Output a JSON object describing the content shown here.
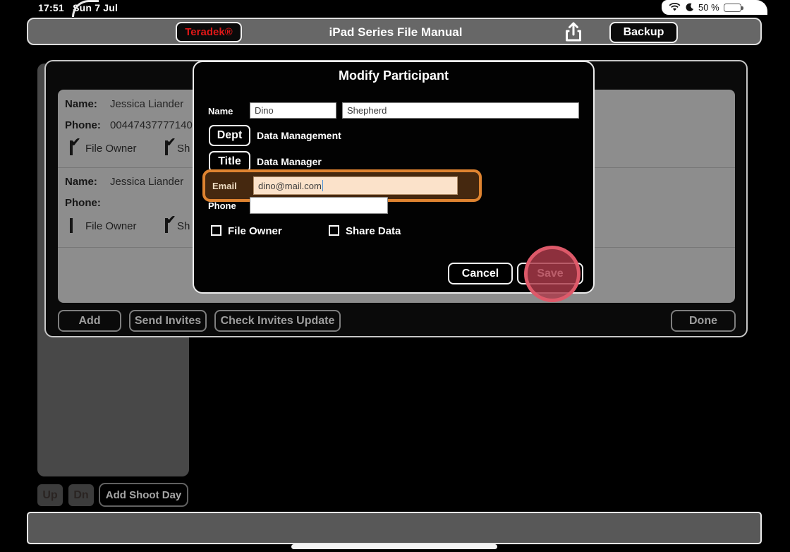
{
  "status_bar": {
    "time": "17:51",
    "date": "Sun 7 Jul",
    "battery_percent": "50 %"
  },
  "toolbar": {
    "brand": "Teradek®",
    "title": "iPad Series File Manual",
    "backup_label": "Backup"
  },
  "participants": {
    "rows": [
      {
        "name_label": "Name:",
        "name": "Jessica Liander",
        "phone_label": "Phone:",
        "phone": "00447437777140",
        "file_owner_label": "File Owner",
        "share_label": "Sh",
        "file_owner_checked": true,
        "share_checked": true
      },
      {
        "name_label": "Name:",
        "name": "Jessica Liander",
        "phone_label": "Phone:",
        "phone": "",
        "file_owner_label": "File Owner",
        "share_label": "Sh",
        "file_owner_checked": false,
        "share_checked": true
      }
    ],
    "buttons": {
      "add": "Add",
      "send_invites": "Send Invites",
      "check_invites": "Check Invites Update",
      "done": "Done"
    }
  },
  "shoot_day": {
    "up": "Up",
    "dn": "Dn",
    "add_shoot_day": "Add Shoot Day"
  },
  "modal": {
    "title": "Modify Participant",
    "name_label": "Name",
    "first_name": "Dino",
    "last_name": "Shepherd",
    "dept_button": "Dept",
    "dept_value": "Data Management",
    "title_button": "Title",
    "title_value": "Data Manager",
    "email_label": "Email",
    "email_value": "dino@mail.com",
    "phone_label": "Phone",
    "phone_value": "",
    "file_owner_label": "File Owner",
    "share_data_label": "Share Data",
    "cancel_label": "Cancel",
    "save_label": "Save"
  },
  "icons": {
    "check": "✔"
  },
  "colors": {
    "highlight_orange": "#de8330",
    "highlight_bg": "#45280f",
    "tap_red": "#ac3a4a",
    "brand_red": "#e01818"
  }
}
